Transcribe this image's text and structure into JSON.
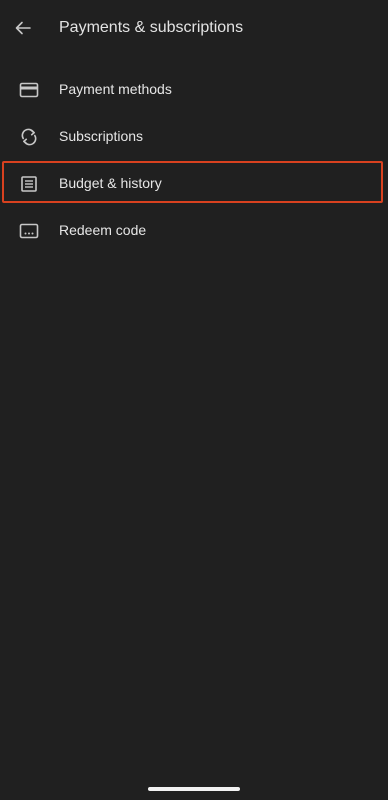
{
  "header": {
    "title": "Payments & subscriptions",
    "back_icon": "arrow-back-icon"
  },
  "menu": {
    "items": [
      {
        "label": "Payment methods",
        "icon": "credit-card-icon"
      },
      {
        "label": "Subscriptions",
        "icon": "sync-icon"
      },
      {
        "label": "Budget & history",
        "icon": "list-document-icon",
        "highlighted": true
      },
      {
        "label": "Redeem code",
        "icon": "code-card-icon"
      }
    ]
  },
  "colors": {
    "background": "#202020",
    "text": "#e6e6e6",
    "icon": "#c7c7c7",
    "highlight_border": "#d8411f",
    "home_indicator": "#f2f2f2"
  }
}
